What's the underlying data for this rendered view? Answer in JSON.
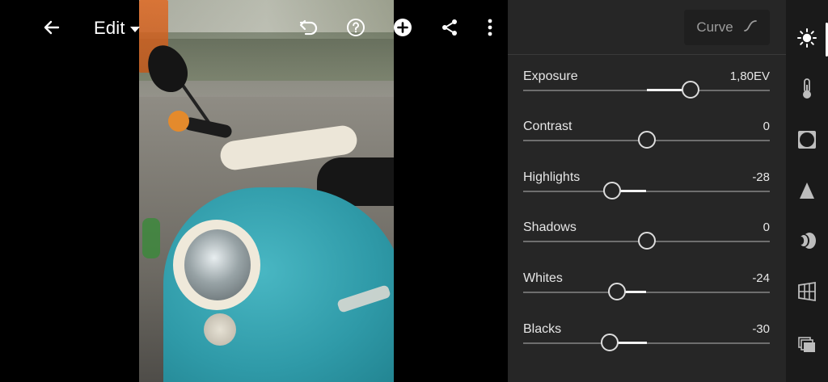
{
  "toolbar": {
    "edit_label": "Edit",
    "icons": [
      "back-arrow-icon",
      "undo-icon",
      "help-icon",
      "add-icon",
      "share-icon",
      "more-icon"
    ]
  },
  "panel": {
    "curve_label": "Curve",
    "sliders": [
      {
        "name": "Exposure",
        "value": "1,80EV",
        "level": 0.36
      },
      {
        "name": "Contrast",
        "value": "0",
        "level": 0
      },
      {
        "name": "Highlights",
        "value": "-28",
        "level": -0.28
      },
      {
        "name": "Shadows",
        "value": "0",
        "level": 0
      },
      {
        "name": "Whites",
        "value": "-24",
        "level": -0.24
      },
      {
        "name": "Blacks",
        "value": "-30",
        "level": -0.3
      }
    ]
  },
  "rail": {
    "items": [
      "light-icon",
      "color-temperature-icon",
      "effects-vignette-icon",
      "detail-icon",
      "optics-lens-icon",
      "geometry-icon",
      "presets-icon"
    ],
    "active": "light-icon"
  },
  "colors": {
    "panel_bg": "#262626",
    "rail_bg": "#1a1a1a",
    "accent": "#ffffff",
    "track": "#6e6e6e"
  }
}
